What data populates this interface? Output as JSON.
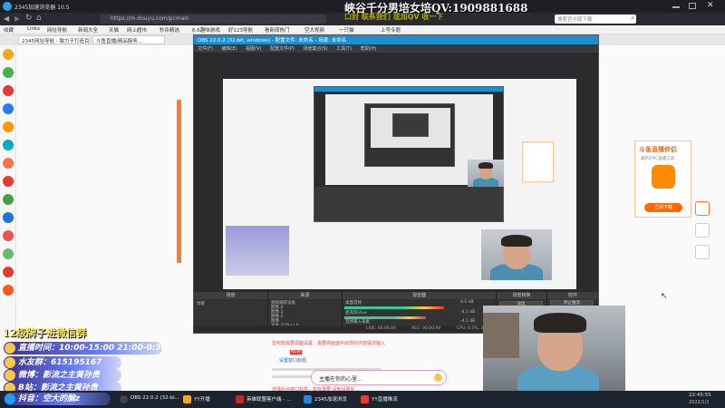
{
  "browser": {
    "window_title": "2345加速浏览器 10.5",
    "url": "https://m.douyu.com/pcmain",
    "search_placeholder": "搜索官方版下载",
    "bookmarks": [
      "收藏",
      "Links",
      "网址导航",
      "新闻大全",
      "天猫",
      "网上超市",
      "秒杀精选",
      "6.6趣味游戏",
      "好123导航",
      "看新闻热门",
      "空大视频",
      "一只猫",
      "上号专题"
    ],
    "tabs": [
      "2345网址导航 - 致力于打造百...",
      "斗鱼直播|精品服务..."
    ]
  },
  "sidebar": {
    "icons": [
      {
        "name": "star-icon",
        "color": "#f5a623"
      },
      {
        "name": "clock-icon",
        "color": "#4caf50"
      },
      {
        "name": "red-app-icon",
        "color": "#e53935"
      },
      {
        "name": "blue-app-icon",
        "color": "#2979ff"
      },
      {
        "name": "orange-app-icon",
        "color": "#ff9800"
      },
      {
        "name": "cyan-app-icon",
        "color": "#00acc1"
      },
      {
        "name": "game-icon",
        "color": "#ff7043"
      },
      {
        "name": "jd-icon",
        "color": "#e53935"
      },
      {
        "name": "chrome-icon",
        "color": "#43a047"
      },
      {
        "name": "tv-icon",
        "color": "#1976d2"
      },
      {
        "name": "note-icon",
        "color": "#ef5350"
      },
      {
        "name": "video-icon",
        "color": "#66bb6a"
      },
      {
        "name": "weibo-icon",
        "color": "#e53935"
      },
      {
        "name": "six-icon",
        "color": "#ff5722"
      }
    ]
  },
  "obs": {
    "title": "OBS 22.0.2 (32-bit, windows) - 配置文件: 未命名 - 场景: 未命名",
    "menu": [
      "文件(F)",
      "编辑(E)",
      "视图(V)",
      "配置文件(P)",
      "场景集合(S)",
      "工具(T)",
      "帮助(H)"
    ],
    "docks": {
      "scenes": {
        "title": "场景",
        "items": [
          "场景"
        ]
      },
      "sources": {
        "title": "来源",
        "items": [
          "视频捕获设备",
          "图像 4",
          "图像 3",
          "图像 2",
          "图像",
          "文本 (GDI+) 4",
          "文本 (GDI+) 3"
        ]
      },
      "mixer": {
        "title": "混音器",
        "items": [
          "桌面音频",
          "麦克风/Aux",
          "音频输入采集"
        ],
        "levels": [
          "0.0 dB",
          "-4.1 dB",
          "-4.1 dB"
        ]
      },
      "transitions": {
        "title": "场景转换",
        "mode": "淡出",
        "duration_label": "时长",
        "duration_value": "300ms"
      },
      "controls": {
        "title": "控件",
        "buttons": [
          "停止推流",
          "开始录制",
          "工作室模式",
          "设置",
          "退出"
        ]
      }
    },
    "status": {
      "live": "LIVE: 00:00:00",
      "rec": "REC: 00:00:00",
      "cpu": "CPU: 0.3%, 30.00 fps"
    }
  },
  "overlay": {
    "top_banner": "峡谷千分男培女培QV:1909881688",
    "top_banner_sub": "口封 联系我们 或加QV 收一下",
    "wechat_hint": "12级牌子进微信群",
    "live_time_label": "直播时间：",
    "live_time_value": "10:00-15:00 21:00-0:30",
    "qq_label": "水友群：",
    "qq_value": "615195167",
    "weibo_label": "微博：",
    "weibo_value": "影流之主黄孙贵",
    "bilibili_label": "B站：",
    "bilibili_value": "影流之主黄孙贵",
    "douyin_label": "抖音：",
    "douyin_value": "空大的脑z"
  },
  "page": {
    "red_notice_1": "您可能需要调整设置，需要将画面中出现的内容提前输入",
    "red_notice_2": "选择后台窗口标签，如有需要 请到设置处...",
    "new_badge": "NEW",
    "link_label": "设置窗口标题",
    "chat_popup": "主播在你的心里..."
  },
  "promo": {
    "title": "斗鱼直播伴侣",
    "subtitle": "最新的PC直播工具",
    "button": "立即下载",
    "accent": "#ff6a00"
  },
  "taskbar": {
    "items": [
      {
        "label": "空大的脑z",
        "color": "#1da1f2"
      },
      {
        "label": "OBS 22.0.2 (32-bi...",
        "color": "#444"
      },
      {
        "label": "YY开播",
        "color": "#f5a623"
      },
      {
        "label": "英雄联盟客户端 - ...",
        "color": "#c62828"
      },
      {
        "label": "2345加速浏览",
        "color": "#1e88e5"
      },
      {
        "label": "YY直播推流",
        "color": "#e53935"
      }
    ],
    "time": "22:45:55",
    "date": "2022/1/2"
  }
}
